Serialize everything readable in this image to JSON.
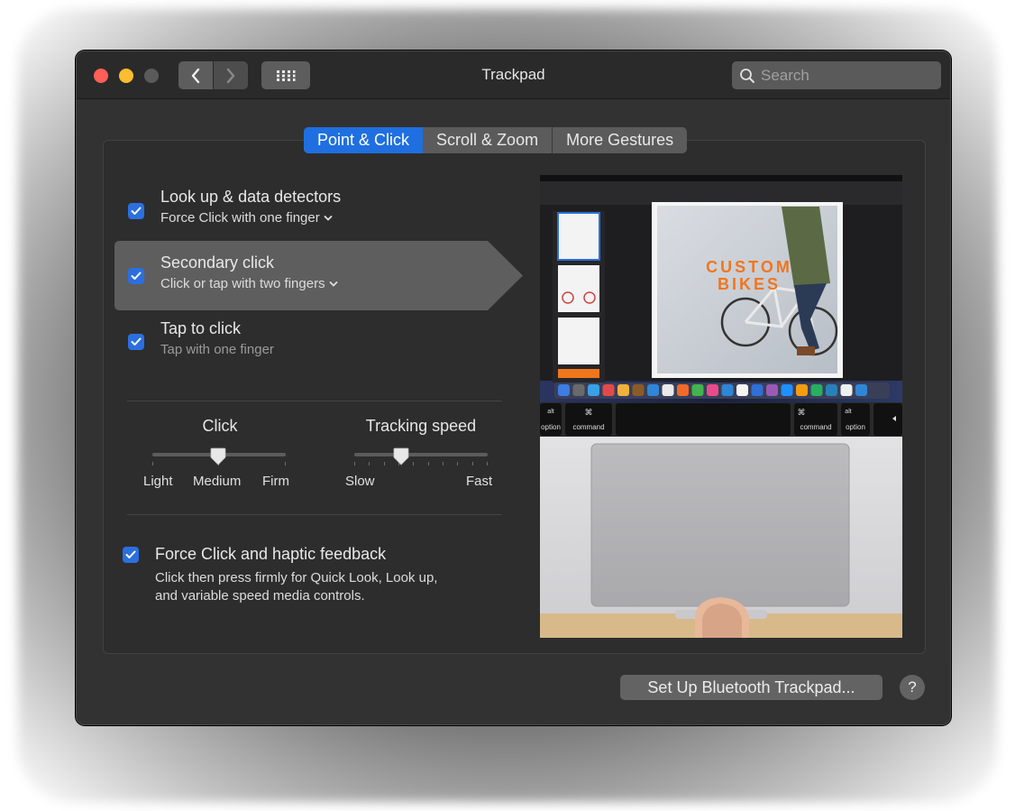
{
  "window": {
    "title": "Trackpad"
  },
  "search": {
    "placeholder": "Search"
  },
  "tabs": [
    {
      "label": "Point & Click",
      "active": true
    },
    {
      "label": "Scroll & Zoom",
      "active": false
    },
    {
      "label": "More Gestures",
      "active": false
    }
  ],
  "options": [
    {
      "title": "Look up & data detectors",
      "subtitle": "Force Click with one finger",
      "has_menu": true,
      "checked": true
    },
    {
      "title": "Secondary click",
      "subtitle": "Click or tap with two fingers",
      "has_menu": true,
      "checked": true
    },
    {
      "title": "Tap to click",
      "subtitle": "Tap with one finger",
      "has_menu": false,
      "checked": true
    }
  ],
  "click_slider": {
    "label": "Click",
    "min_label": "Light",
    "mid_label": "Medium",
    "max_label": "Firm",
    "value": "Medium"
  },
  "tracking_slider": {
    "label": "Tracking speed",
    "min_label": "Slow",
    "max_label": "Fast",
    "value_fraction": 0.35
  },
  "force_click": {
    "title": "Force Click and haptic feedback",
    "description_line1": "Click then press firmly for Quick Look, Look up,",
    "description_line2": "and variable speed media controls.",
    "checked": true
  },
  "preview": {
    "poster_line1": "CUSTOM",
    "poster_line2": "BIKES",
    "key_option_left": "option",
    "key_command_left": "command",
    "key_command_right": "command",
    "key_option_right": "option",
    "key_alt_left": "alt",
    "key_alt_right": "alt",
    "key_cmd_symbol": "⌘"
  },
  "buttons": {
    "bluetooth": "Set Up Bluetooth Trackpad...",
    "help": "?"
  },
  "colors": {
    "accent": "#1f6fe0",
    "close": "#ff5f57",
    "minimize": "#febc2e",
    "poster_orange": "#f0761e"
  }
}
